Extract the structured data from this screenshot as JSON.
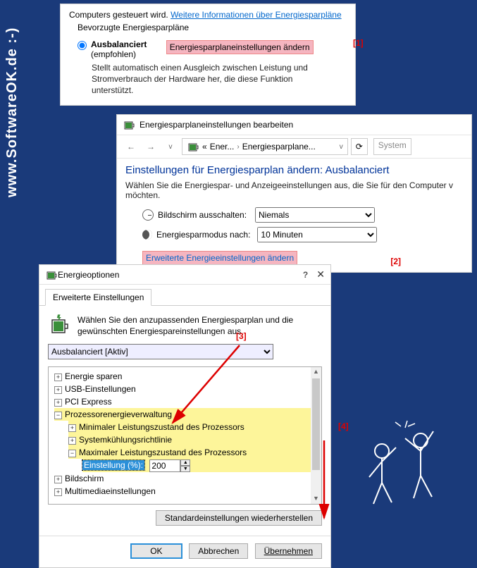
{
  "panel1": {
    "intro_prefix": "Computers gesteuert wird. ",
    "link": "Weitere Informationen über Energiesparpläne",
    "group_label": "Bevorzugte Energiesparpläne",
    "option_name": "Ausbalanciert",
    "option_rec": "(empfohlen)",
    "change_link": "Energiesparplaneinstellungen ändern",
    "option_desc": "Stellt automatisch einen Ausgleich zwischen Leistung und Stromverbrauch der Hardware her, die diese Funktion unterstützt."
  },
  "panel2": {
    "title": "Energiesparplaneinstellungen bearbeiten",
    "crumb_a": "Ener...",
    "crumb_b": "Energiesparplane...",
    "search_ph": "System",
    "heading": "Einstellungen für Energiesparplan ändern: Ausbalanciert",
    "sub": "Wählen Sie die Energiespar- und Anzeigeeinstellungen aus, die Sie für den Computer v möchten.",
    "row1_label": "Bildschirm ausschalten:",
    "row1_value": "Niemals",
    "row2_label": "Energiesparmodus nach:",
    "row2_value": "10 Minuten",
    "adv_link": "Erweiterte Energieeinstellungen ändern"
  },
  "panel3": {
    "title": "Energieoptionen",
    "tab": "Erweiterte Einstellungen",
    "intro": "Wählen Sie den anzupassenden Energiesparplan und die gewünschten Energiespareinstellungen aus.",
    "plan_select": "Ausbalanciert [Aktiv]",
    "tree": {
      "n1": "Energie sparen",
      "n2": "USB-Einstellungen",
      "n3": "PCI Express",
      "n4": "Prozessorenergieverwaltung",
      "n4a": "Minimaler Leistungszustand des Prozessors",
      "n4b": "Systemkühlungsrichtlinie",
      "n4c": "Maximaler Leistungszustand des Prozessors",
      "n4c_setting_label": "Einstellung (%):",
      "n4c_setting_value": "200",
      "n5": "Bildschirm",
      "n6": "Multimediaeinstellungen"
    },
    "restore_btn": "Standardeinstellungen wiederherstellen",
    "ok_btn": "OK",
    "cancel_btn": "Abbrechen",
    "apply_btn": "Übernehmen"
  },
  "annotations": {
    "a1": "[1]",
    "a2": "[2]",
    "a3": "[3]",
    "a4": "[4]"
  },
  "watermark": "www.SoftwareOK.de :-)",
  "icons": {
    "help": "?",
    "close": "✕",
    "minus": "−",
    "plus": "+",
    "chev_r": "›",
    "chev_d": "v",
    "back": "←",
    "fwd": "→",
    "reload": "⟳",
    "dd": "«",
    "up": "▲",
    "down": "▼"
  }
}
